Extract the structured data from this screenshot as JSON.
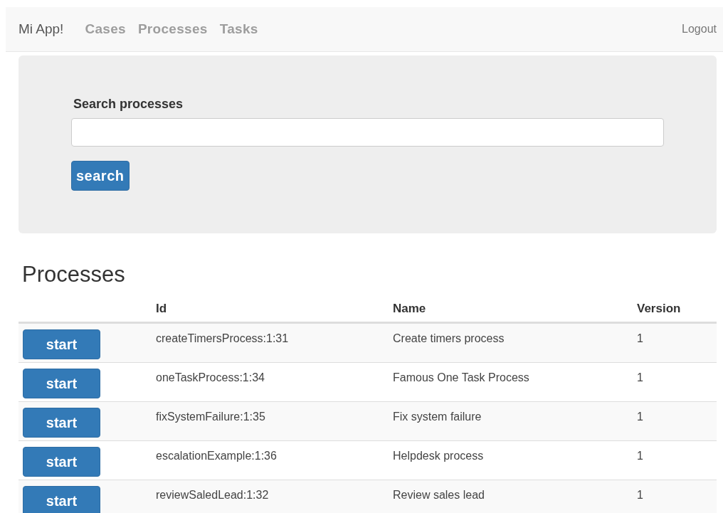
{
  "navbar": {
    "brand": "Mi App!",
    "links": [
      "Cases",
      "Processes",
      "Tasks"
    ],
    "logout": "Logout"
  },
  "search": {
    "label": "Search processes",
    "button": "search"
  },
  "processes": {
    "title": "Processes",
    "columns": [
      "Id",
      "Name",
      "Version"
    ],
    "rows": [
      {
        "action": "start",
        "id": "createTimersProcess:1:31",
        "name": "Create timers process",
        "version": "1"
      },
      {
        "action": "start",
        "id": "oneTaskProcess:1:34",
        "name": "Famous One Task Process",
        "version": "1"
      },
      {
        "action": "start",
        "id": "fixSystemFailure:1:35",
        "name": "Fix system failure",
        "version": "1"
      },
      {
        "action": "start",
        "id": "escalationExample:1:36",
        "name": "Helpdesk process",
        "version": "1"
      },
      {
        "action": "start",
        "id": "reviewSaledLead:1:32",
        "name": "Review sales lead",
        "version": "1"
      }
    ]
  }
}
